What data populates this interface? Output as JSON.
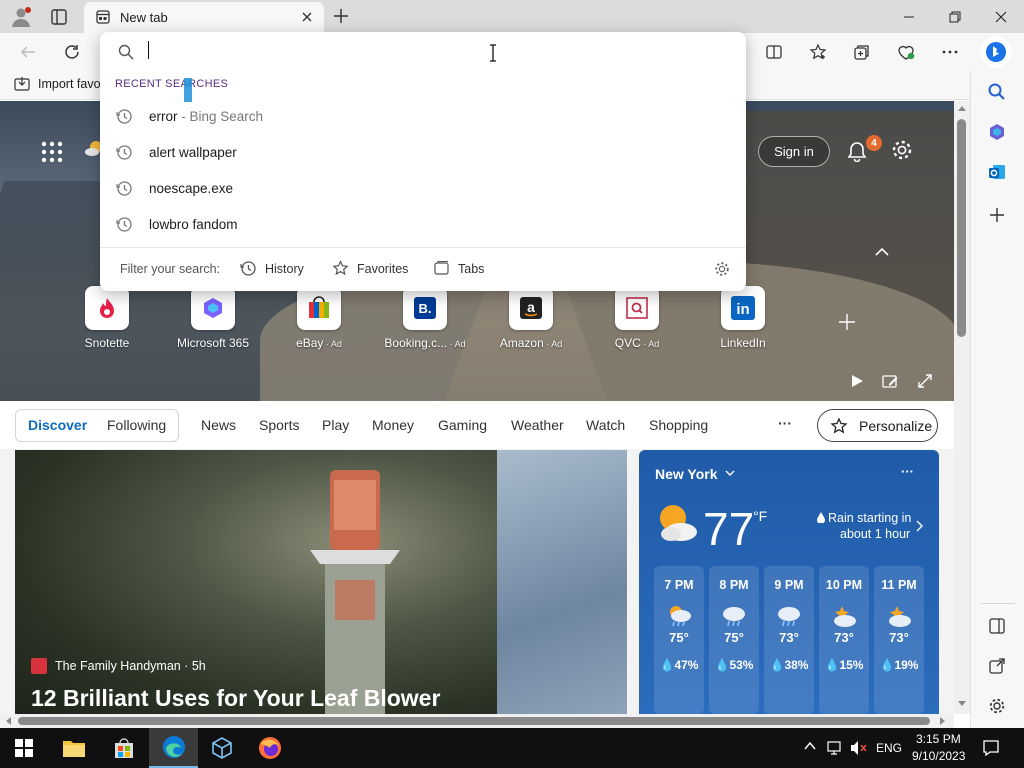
{
  "titlebar": {
    "tab_title": "New tab",
    "min_label": "—",
    "restore_label": "❐",
    "close_label": "✕"
  },
  "favorites_bar": {
    "import_label": "Import favo"
  },
  "omnibox": {
    "value": "",
    "section_label": "RECENT SEARCHES",
    "recent": [
      {
        "text": "error",
        "suffix": " - Bing Search"
      },
      {
        "text": "alert wallpaper",
        "suffix": ""
      },
      {
        "text": "noescape.exe",
        "suffix": ""
      },
      {
        "text": "lowbro fandom",
        "suffix": ""
      }
    ],
    "filter_label": "Filter your search:",
    "filters": [
      "History",
      "Favorites",
      "Tabs"
    ]
  },
  "hero": {
    "sign_in": "Sign in",
    "notification_count": "4"
  },
  "quick_links": [
    {
      "label": "Snotette",
      "ad": ""
    },
    {
      "label": "Microsoft 365",
      "ad": ""
    },
    {
      "label": "eBay",
      "ad": " · Ad"
    },
    {
      "label": "Booking.c...",
      "ad": " · Ad"
    },
    {
      "label": "Amazon",
      "ad": " · Ad"
    },
    {
      "label": "QVC",
      "ad": " · Ad"
    },
    {
      "label": "LinkedIn",
      "ad": ""
    }
  ],
  "feed_nav": {
    "pill_tabs": [
      "Discover",
      "Following"
    ],
    "tabs": [
      "News",
      "Sports",
      "Play",
      "Money",
      "Gaming",
      "Weather",
      "Watch",
      "Shopping"
    ],
    "more": "···",
    "personalize": "Personalize"
  },
  "article": {
    "source": "The Family Handyman · 5h",
    "headline": "12 Brilliant Uses for Your Leaf Blower"
  },
  "weather": {
    "location": "New York",
    "temp": "77",
    "unit": "°F",
    "summary_line1": "Rain starting in",
    "summary_line2": "about 1 hour",
    "more": "···",
    "hours": [
      {
        "time": "7 PM",
        "temp": "75°",
        "precip": "47%"
      },
      {
        "time": "8 PM",
        "temp": "75°",
        "precip": "53%"
      },
      {
        "time": "9 PM",
        "temp": "73°",
        "precip": "38%"
      },
      {
        "time": "10 PM",
        "temp": "73°",
        "precip": "15%"
      },
      {
        "time": "11 PM",
        "temp": "73°",
        "precip": "19%"
      }
    ]
  },
  "taskbar": {
    "lang": "ENG",
    "time": "3:15 PM",
    "date": "9/10/2023"
  },
  "colors": {
    "accent": "#0f6cbd",
    "titlebar": "#dcdcdc",
    "taskbar": "#101010",
    "weather_card": "#2c6cbd",
    "notif_badge": "#e66a2e"
  }
}
